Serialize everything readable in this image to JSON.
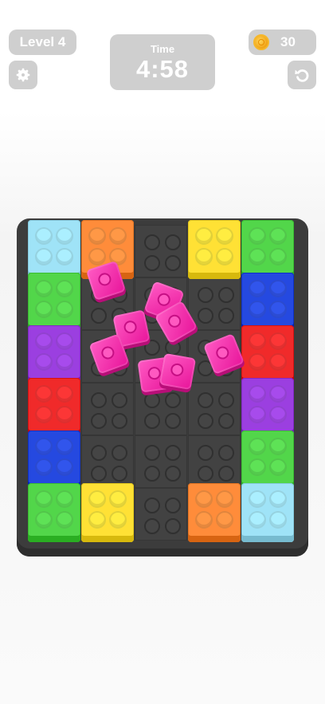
{
  "hud": {
    "level_label": "Level 4",
    "timer_label": "Time",
    "timer_value": "4:58",
    "coin_count": "30"
  },
  "icons": {
    "settings": "gear-icon",
    "undo": "undo-arrow-icon",
    "coin": "coin-icon"
  },
  "colors": {
    "lightblue": "#9fe3f7",
    "orange": "#ff8c3a",
    "yellow": "#ffe135",
    "green": "#52d64a",
    "blue": "#2549e0",
    "purple": "#9b3fe0",
    "red": "#f02a2a",
    "pink": "#ff3fb5",
    "empty": "#424242"
  },
  "board": {
    "columns": 5,
    "rows": 6,
    "grid": [
      [
        "lightblue",
        "orange",
        "empty",
        "yellow",
        "green"
      ],
      [
        "green",
        "empty",
        "empty",
        "empty",
        "blue"
      ],
      [
        "purple",
        "empty",
        "empty",
        "empty",
        "red"
      ],
      [
        "red",
        "empty",
        "empty",
        "empty",
        "purple"
      ],
      [
        "blue",
        "empty",
        "empty",
        "empty",
        "green"
      ],
      [
        "green",
        "yellow",
        "empty",
        "orange",
        "lightblue"
      ]
    ],
    "falling_pieces": [
      "pink",
      "pink",
      "pink",
      "pink",
      "pink",
      "pink",
      "pink",
      "pink"
    ]
  }
}
